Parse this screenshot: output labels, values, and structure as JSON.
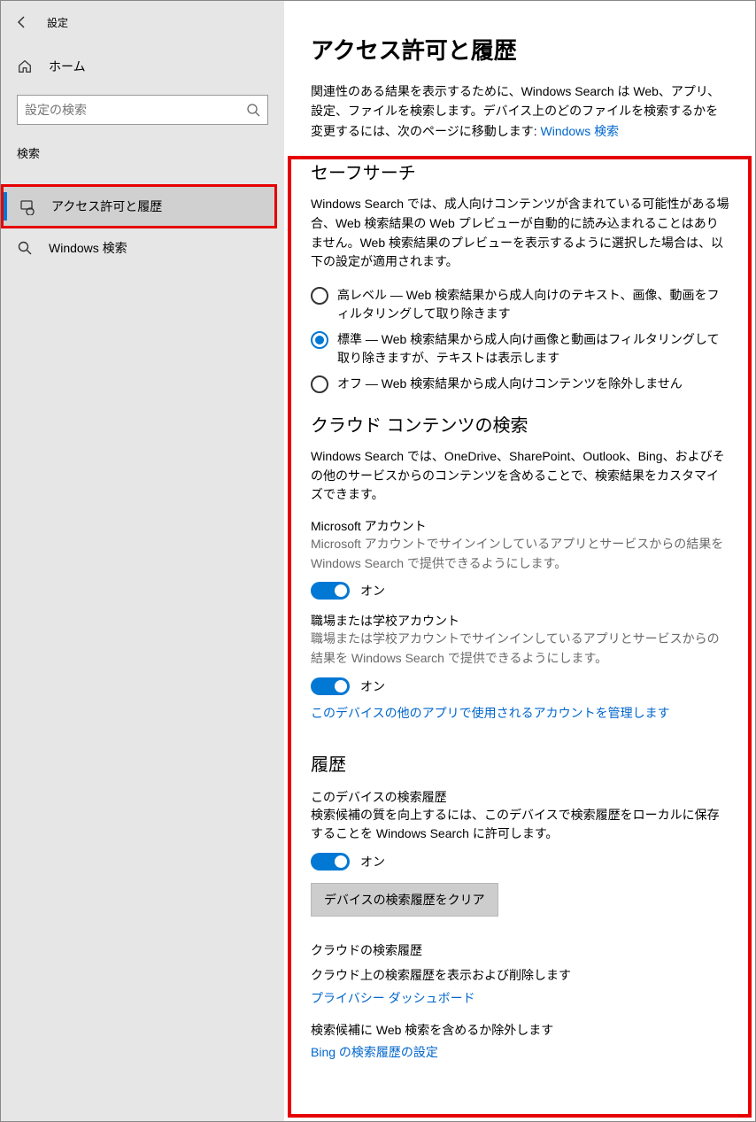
{
  "window": {
    "title": "設定"
  },
  "sidebar": {
    "home": "ホーム",
    "search_placeholder": "設定の検索",
    "category": "検索",
    "items": [
      {
        "label": "アクセス許可と履歴",
        "selected": true
      },
      {
        "label": "Windows 検索",
        "selected": false
      }
    ]
  },
  "page": {
    "title": "アクセス許可と履歴",
    "intro_prefix": "関連性のある結果を表示するために、Windows Search は Web、アプリ、設定、ファイルを検索します。デバイス上のどのファイルを検索するかを変更するには、次のページに移動します: ",
    "intro_link": "Windows 検索"
  },
  "safesearch": {
    "heading": "セーフサーチ",
    "desc": "Windows Search では、成人向けコンテンツが含まれている可能性がある場合、Web 検索結果の Web プレビューが自動的に読み込まれることはありません。Web 検索結果のプレビューを表示するように選択した場合は、以下の設定が適用されます。",
    "options": [
      "高レベル — Web 検索結果から成人向けのテキスト、画像、動画をフィルタリングして取り除きます",
      "標準 — Web 検索結果から成人向け画像と動画はフィルタリングして取り除きますが、テキストは表示します",
      "オフ — Web 検索結果から成人向けコンテンツを除外しません"
    ],
    "selected_index": 1
  },
  "cloud": {
    "heading": "クラウド コンテンツの検索",
    "desc": "Windows Search では、OneDrive、SharePoint、Outlook、Bing、およびその他のサービスからのコンテンツを含めることで、検索結果をカスタマイズできます。",
    "ms_account_label": "Microsoft アカウント",
    "ms_account_desc": "Microsoft アカウントでサインインしているアプリとサービスからの結果を Windows Search で提供できるようにします。",
    "work_account_label": "職場または学校アカウント",
    "work_account_desc": "職場または学校アカウントでサインインしているアプリとサービスからの結果を Windows Search で提供できるようにします。",
    "toggle_on": "オン",
    "manage_link": "このデバイスの他のアプリで使用されるアカウントを管理します"
  },
  "history": {
    "heading": "履歴",
    "device_label": "このデバイスの検索履歴",
    "device_desc": "検索候補の質を向上するには、このデバイスで検索履歴をローカルに保存することを Windows Search に許可します。",
    "toggle_on": "オン",
    "clear_button": "デバイスの検索履歴をクリア",
    "cloud_label": "クラウドの検索履歴",
    "cloud_desc": "クラウド上の検索履歴を表示および削除します",
    "privacy_link": "プライバシー ダッシュボード",
    "bing_desc": "検索候補に Web 検索を含めるか除外します",
    "bing_link": "Bing の検索履歴の設定"
  }
}
